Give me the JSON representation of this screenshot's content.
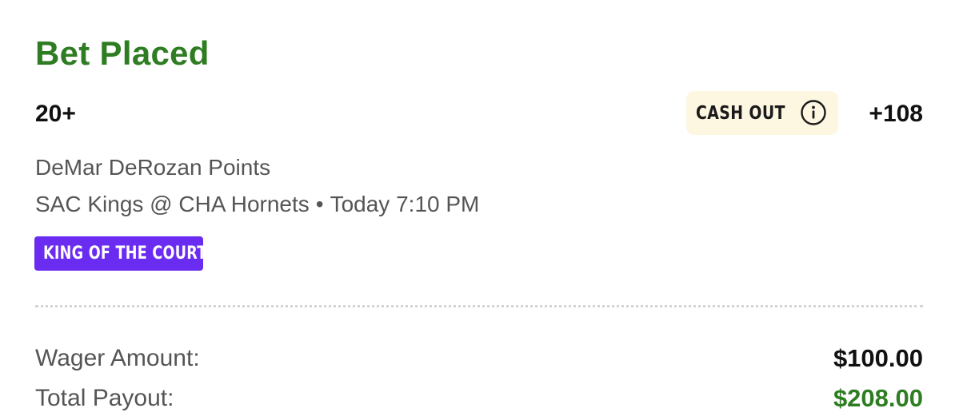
{
  "header": {
    "title": "Bet Placed"
  },
  "bet": {
    "selection": "20+",
    "cash_out_label": "CASH OUT",
    "odds": "+108",
    "market": "DeMar DeRozan Points",
    "event": "SAC Kings @ CHA Hornets",
    "separator": "•",
    "start_time": "Today 7:10 PM",
    "promo_badge": "KING OF THE COURT"
  },
  "summary": {
    "wager_label": "Wager Amount:",
    "wager_value": "$100.00",
    "payout_label": "Total Payout:",
    "payout_value": "$208.00"
  },
  "icons": {
    "cash_out_info": "info-icon"
  },
  "colors": {
    "title_green": "#2e7d22",
    "payout_green": "#2e7d22",
    "cash_out_bg": "#fdf7e2",
    "badge_purple": "#6a2cf0"
  }
}
